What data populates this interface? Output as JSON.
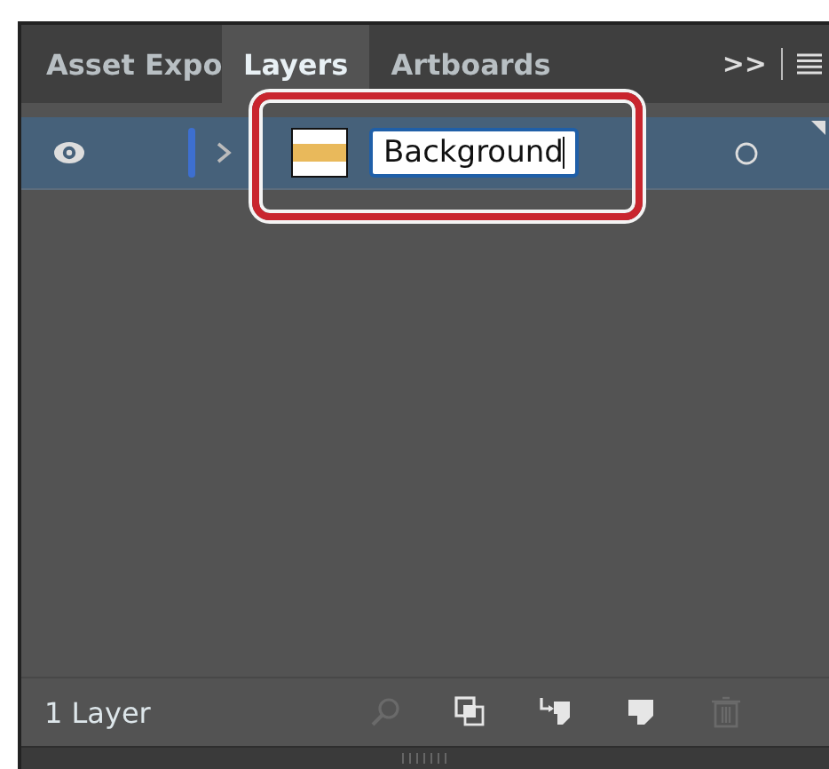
{
  "tabs": [
    {
      "label": "Asset Expo",
      "selected": false
    },
    {
      "label": "Layers",
      "selected": true
    },
    {
      "label": "Artboards",
      "selected": false
    }
  ],
  "overflow": ">>",
  "layers": [
    {
      "visible": true,
      "expanded": false,
      "color": "#3d6fd0",
      "name": "Background",
      "editing": true,
      "selected": true
    }
  ],
  "status": "1 Layer",
  "footer_buttons": [
    {
      "kind": "search",
      "disabled": true
    },
    {
      "kind": "clip",
      "disabled": false
    },
    {
      "kind": "sublayer",
      "disabled": false
    },
    {
      "kind": "new",
      "disabled": false
    },
    {
      "kind": "trash",
      "disabled": true
    }
  ],
  "callout": true
}
